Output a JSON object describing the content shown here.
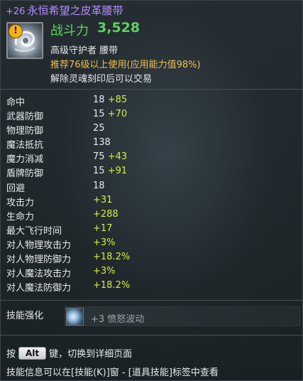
{
  "item": {
    "enchant": "+26",
    "name": "永恒希望之皮革腰带",
    "icon": "leather-belt-icon",
    "badge_icon": "warning-icon",
    "badge_glyph": "!",
    "power_label": "战斗力",
    "power_value": "3,528",
    "grade_type": "高级守护者  腰带",
    "requirement": "推荐76级以上使用(应用能力值98%)",
    "trade_note": "解除灵魂刻印后可以交易"
  },
  "stats": [
    {
      "name": "命中",
      "base": "18",
      "bonus": "+85"
    },
    {
      "name": "武器防御",
      "base": "15",
      "bonus": "+70"
    },
    {
      "name": "物理防御",
      "base": "25",
      "bonus": ""
    },
    {
      "name": "魔法抵抗",
      "base": "138",
      "bonus": ""
    },
    {
      "name": "魔力消减",
      "base": "75",
      "bonus": "+43"
    },
    {
      "name": "盾牌防御",
      "base": "15",
      "bonus": "+91"
    },
    {
      "name": "回避",
      "base": "18",
      "bonus": ""
    },
    {
      "name": "攻击力",
      "base": "",
      "bonus": "+31"
    },
    {
      "name": "生命力",
      "base": "",
      "bonus": "+288"
    },
    {
      "name": "最大飞行时间",
      "base": "",
      "bonus": "+17"
    },
    {
      "name": "对人物理攻击力",
      "base": "",
      "bonus": "+3%"
    },
    {
      "name": "对人物理防御力",
      "base": "",
      "bonus": "+18.2%"
    },
    {
      "name": "对人魔法攻击力",
      "base": "",
      "bonus": "+3%"
    },
    {
      "name": "对人魔法防御力",
      "base": "",
      "bonus": "+18.2%"
    }
  ],
  "skill": {
    "label": "技能强化",
    "icon": "skill-wave-icon",
    "text": "+3 愤怒波动"
  },
  "footer": {
    "alt_prefix": "按",
    "alt_key": "Alt",
    "alt_suffix": "键，切换到详细页面",
    "info": "技能信息可以在[技能(K)]窗 - [道具技能]标签中查看"
  },
  "colors": {
    "title": "#b58cff",
    "power": "#5ed25e",
    "requirement": "#f2c04a",
    "bonus": "#d6ee3a"
  }
}
